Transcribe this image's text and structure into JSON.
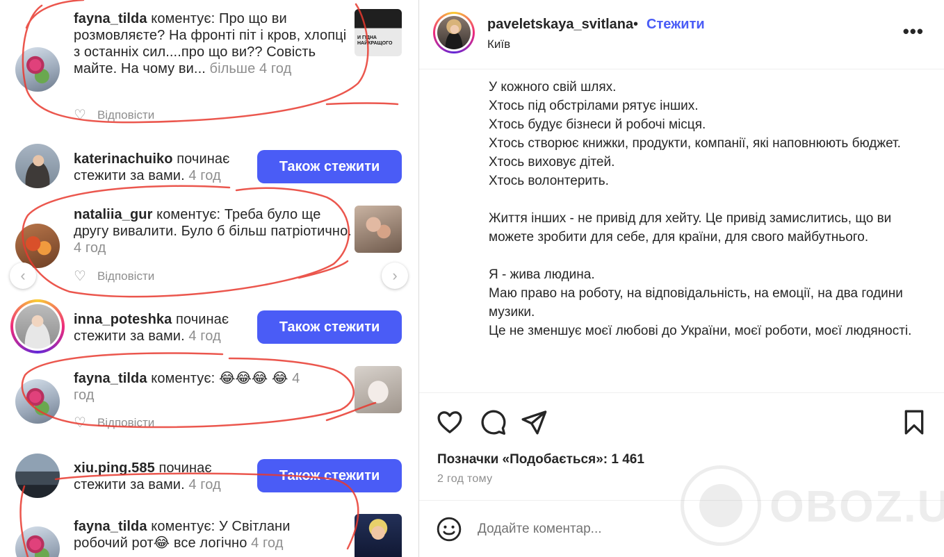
{
  "notifications": {
    "items": [
      {
        "user": "fayna_tilda",
        "text": " коментує: Про що ви розмовляєте? На фронті піт і кров, хлопці з останніх сил....про що ви?? Совість майте. На чому ви...",
        "more": " більше",
        "time": " 4 год",
        "reply": "Відповісти"
      },
      {
        "user": "katerinachuiko",
        "text": " починає стежити за вами.",
        "time": " 4 год",
        "button": "Також стежити"
      },
      {
        "user": "nataliia_gur",
        "text": " коментує: Треба було ще другу вивалити. Було б більш патріотично.",
        "time": " 4 год",
        "reply": "Відповісти"
      },
      {
        "user": "inna_poteshka",
        "text": " починає стежити за вами.",
        "time": " 4 год",
        "button": "Також стежити"
      },
      {
        "user": "fayna_tilda",
        "text": " коментує: 😂😂😂 😂",
        "time": " 4 год",
        "reply": "Відповісти"
      },
      {
        "user": "xiu.ping.585",
        "text": " починає стежити за вами.",
        "time": " 4 год",
        "button": "Також стежити"
      },
      {
        "user": "fayna_tilda",
        "text": " коментує: У Світлани робочий рот😂 все логічно",
        "time": " 4 год"
      }
    ],
    "thumb1_text": "И ГІДНА\nНАЙКРАЩОГО",
    "nav_prev": "‹",
    "nav_next": "›",
    "annotation_color": "#e8392f"
  },
  "post": {
    "username": "paveletskaya_svitlana",
    "separator": "•",
    "follow": "Стежити",
    "location": "Київ",
    "more_icon": "•••",
    "caption": [
      "У кожного свій шлях.",
      "Хтось під обстрілами рятує інших.",
      "Хтось будує бізнеси й робочі місця.",
      "Хтось створює книжки, продукти, компанії, які наповнюють бюджет.",
      "Хтось виховує дітей.",
      "Хтось волонтерить.",
      "",
      "Життя інших - не привід для хейту. Це привід замислитись, що ви можете зробити для себе, для країни, для свого майбутнього.",
      "",
      "Я - жива людина.",
      "Маю право на роботу, на відповідальність, на емоції, на два години музики.",
      "Це не зменшує моєї любові до України, моєї роботи, моєї людяності."
    ],
    "likes": "Позначки «Подобається»: 1 461",
    "time": "2 год тому",
    "comment_placeholder": "Додайте коментар...",
    "icons": [
      "heart-icon",
      "comment-icon",
      "share-icon",
      "bookmark-icon",
      "emoji-icon"
    ],
    "accent": "#4a5cf6"
  },
  "watermark": "OBOZ.UA"
}
